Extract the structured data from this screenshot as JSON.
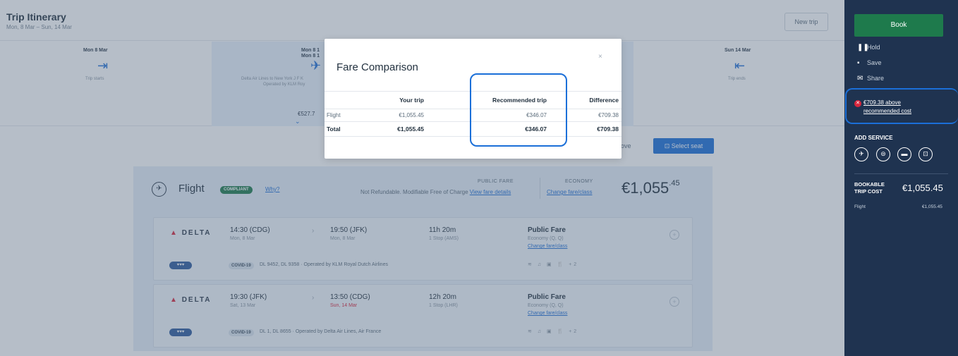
{
  "header": {
    "title": "Trip Itinerary",
    "dates": "Mon, 8 Mar – Sun, 14 Mar",
    "new_trip": "New trip"
  },
  "timeline": {
    "start_day": "Mon 8 Mar",
    "start_label": "Trip starts",
    "mid_day_1": "Mon 8 1",
    "mid_day_2": "Mon 8 1",
    "mid_route": "Delta Air Lines to New York J F K",
    "mid_operated": "Operated by KLM Roy",
    "mid_price": "€527.7",
    "end_day": "Sun 14 Mar",
    "end_label": "Trip ends"
  },
  "actions": {
    "remove": "ove",
    "select_seat": "Select seat"
  },
  "flight": {
    "label": "Flight",
    "compliant": "COMPLIANT",
    "why": "Why?",
    "fare_type": "PUBLIC FARE",
    "refund_text": "Not Refundable. Modifiable Free of Charge ",
    "view_fare_details": "View fare details",
    "class": "ECONOMY",
    "change_fare_class": "Change fare/class",
    "price_main": "€1,055",
    "price_cents": ".45",
    "segments": [
      {
        "airline": "DELTA",
        "dep_time": "14:30 (CDG)",
        "dep_date": "Mon, 8 Mar",
        "arr_time": "19:50 (JFK)",
        "arr_date": "Mon, 8 Mar",
        "duration": "11h 20m",
        "stops": "1 Stop (AMS)",
        "fare": "Public Fare",
        "fare_class": "Economy (Q, Q)",
        "change_fare": "Change fare/class",
        "covid": "COVID-19",
        "info": "DL 9452, DL 9358 · Operated by KLM Royal Dutch Airlines",
        "amenities": "≋ ♫ ▣ 🍴 +2"
      },
      {
        "airline": "DELTA",
        "dep_time": "19:30 (JFK)",
        "dep_date": "Sat, 13 Mar",
        "arr_time": "13:50 (CDG)",
        "arr_date": "Sun, 14 Mar",
        "duration": "12h 20m",
        "stops": "1 Stop (LHR)",
        "fare": "Public Fare",
        "fare_class": "Economy (Q, Q)",
        "change_fare": "Change fare/class",
        "covid": "COVID-19",
        "info": "DL 1, DL 8655 · Operated by Delta Air Lines, Air France",
        "amenities": "≋ ♫ ▣ 🍴 +2"
      }
    ]
  },
  "modal": {
    "title": "Fare Comparison",
    "close": "×",
    "columns": [
      "",
      "Your trip",
      "Recommended trip",
      "Difference"
    ],
    "rows": [
      {
        "label": "Flight",
        "your": "€1,055.45",
        "rec": "€346.07",
        "diff": "€709.38"
      }
    ],
    "total": {
      "label": "Total",
      "your": "€1,055.45",
      "rec": "€346.07",
      "diff": "€709.38"
    }
  },
  "sidebar": {
    "book": "Book",
    "hold": "Hold",
    "save": "Save",
    "share": "Share",
    "warning_line1": "€709.38 above",
    "warning_line2": "recommended cost",
    "add_service": "ADD SERVICE",
    "bookable_1": "BOOKABLE",
    "bookable_2": "TRIP COST",
    "bookable_amount": "€1,055.45",
    "flight_label": "Flight",
    "flight_amount": "€1,055.45"
  },
  "colors": {
    "brand_blue": "#1b6fd8",
    "sidebar_bg": "#1f3350",
    "book_green": "#1e7a4c",
    "delta_red": "#d8263d"
  }
}
